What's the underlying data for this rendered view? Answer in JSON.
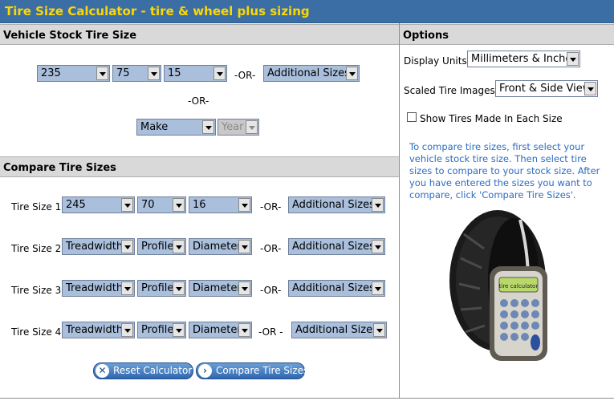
{
  "header": {
    "title": "Tire Size Calculator - tire & wheel plus sizing"
  },
  "stock": {
    "heading": "Vehicle Stock Tire Size",
    "treadwidth": "235",
    "profile": "75",
    "diameter": "15",
    "or1": "-OR-",
    "additional": "Additional Sizes",
    "or2": "-OR-",
    "make": "Make",
    "year": "Year"
  },
  "compare": {
    "heading": "Compare Tire Sizes",
    "rows": [
      {
        "label": "Tire Size 1:",
        "treadwidth": "245",
        "profile": "70",
        "diameter": "16",
        "or": "-OR-",
        "additional": "Additional Sizes"
      },
      {
        "label": "Tire Size 2:",
        "treadwidth": "Treadwidth",
        "profile": "Profile",
        "diameter": "Diameter",
        "or": "-OR-",
        "additional": "Additional Sizes"
      },
      {
        "label": "Tire Size 3:",
        "treadwidth": "Treadwidth",
        "profile": "Profile",
        "diameter": "Diameter",
        "or": "-OR-",
        "additional": "Additional Sizes"
      },
      {
        "label": "Tire Size 4:",
        "treadwidth": "Treadwidth",
        "profile": "Profile",
        "diameter": "Diameter",
        "or": "-OR -",
        "additional": "Additional Sizes"
      }
    ],
    "reset_label": "Reset Calculator",
    "compare_label": "Compare Tire Sizes"
  },
  "options": {
    "heading": "Options",
    "display_units_label": "Display Units:",
    "display_units_value": "Millimeters & Inches",
    "scaled_images_label": "Scaled Tire Images:",
    "scaled_images_value": "Front & Side View",
    "show_tires_label": "Show Tires Made In Each Size",
    "info_text": "To compare tire sizes, first select your vehicle stock tire size. Then select tire sizes to compare to your stock size. After you have entered the sizes you want to compare, click 'Compare Tire Sizes'.",
    "calculator_screen_text": "tire calculator"
  },
  "colors": {
    "title_bg": "#3a6ea5",
    "title_text": "#ffd700",
    "select_bg": "#aabfdc",
    "info_text": "#2b6cc4"
  }
}
